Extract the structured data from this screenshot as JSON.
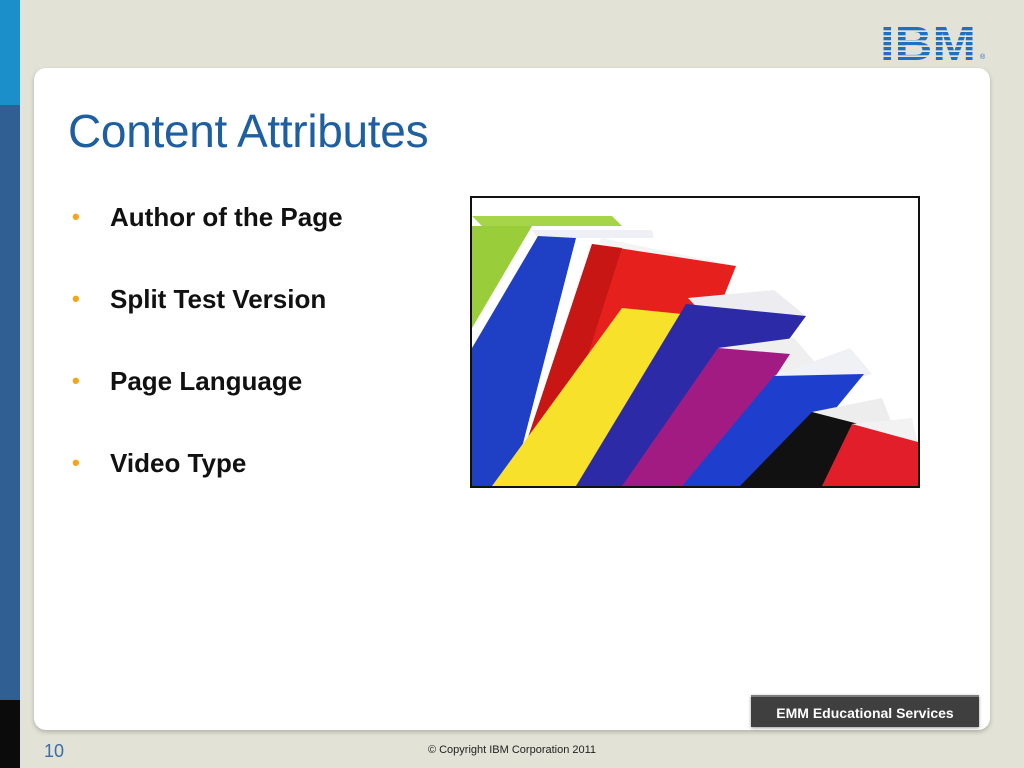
{
  "slide": {
    "title": "Content Attributes",
    "bullets": [
      {
        "label": "Author of the Page"
      },
      {
        "label": "Split Test Version"
      },
      {
        "label": "Page Language"
      },
      {
        "label": "Video Type"
      }
    ],
    "badge": "EMM Educational Services",
    "page_number": "10",
    "copyright": "© Copyright IBM Corporation 2011"
  },
  "logo": {
    "text": "IBM",
    "color": "#1f70c1"
  },
  "image": {
    "subject": "books-stack-image"
  },
  "colors": {
    "title": "#1d5fa1",
    "bullet": "#f3a51b",
    "accent_top": "#1b8fc9",
    "accent_mid": "#2f5f93"
  }
}
